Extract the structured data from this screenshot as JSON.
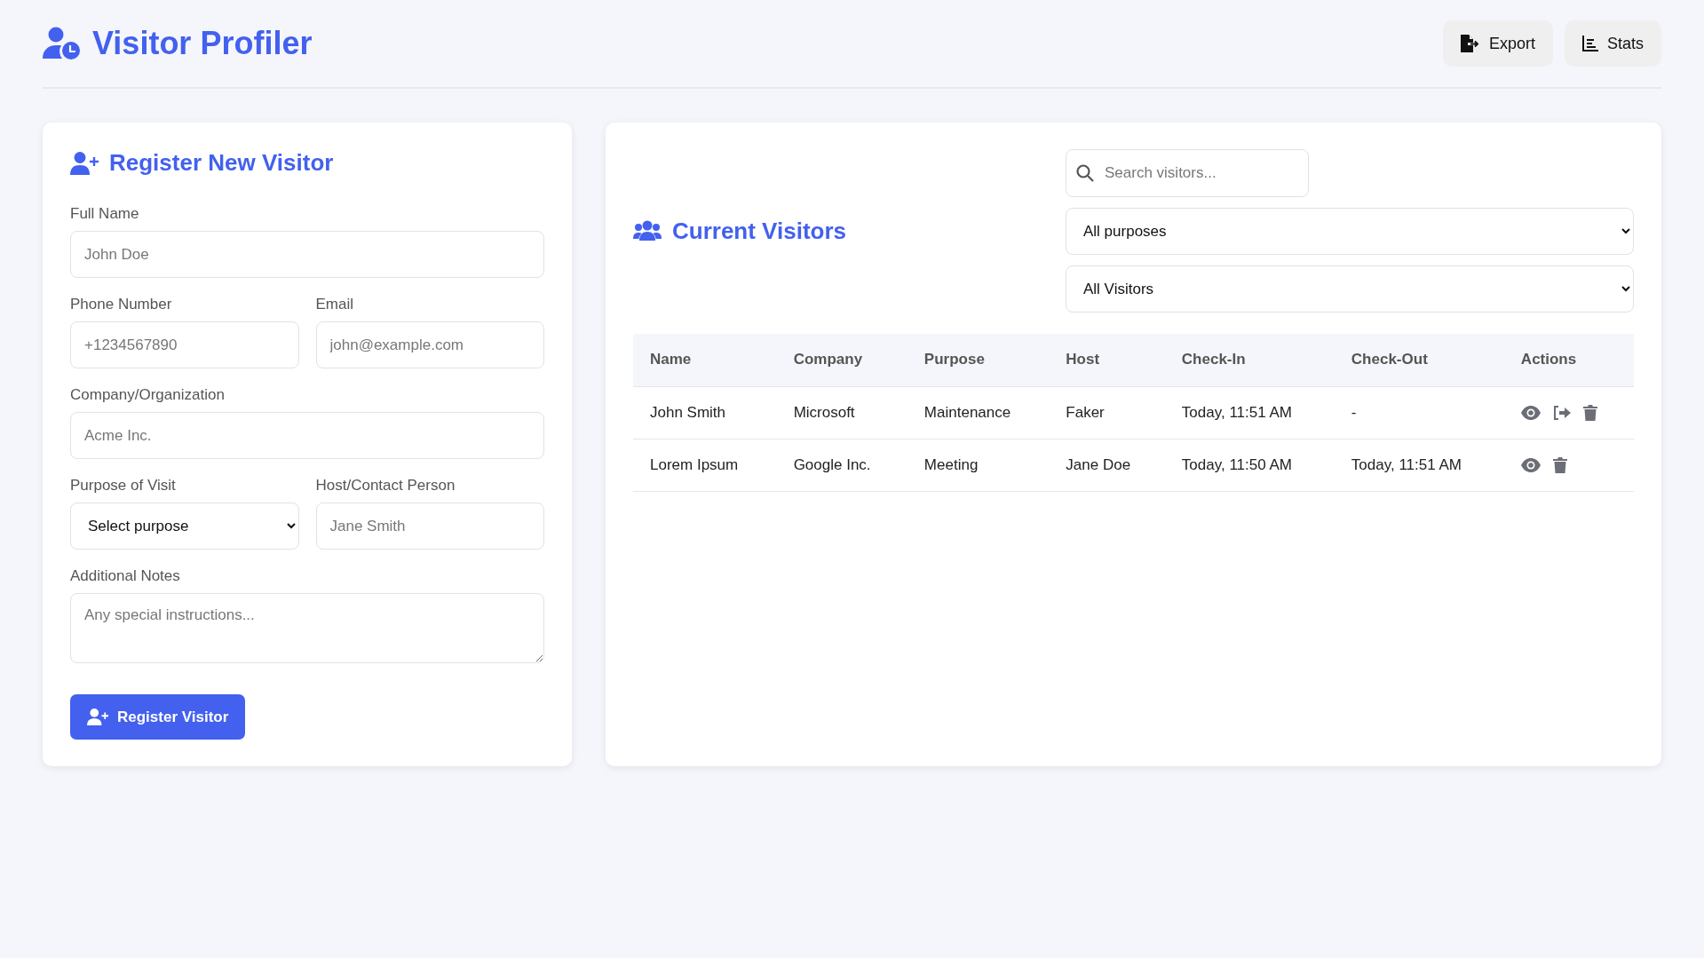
{
  "header": {
    "title": "Visitor Profiler",
    "buttons": [
      {
        "kind": "export",
        "label": "Export"
      },
      {
        "kind": "stats",
        "label": "Stats"
      }
    ]
  },
  "register": {
    "title": "Register New Visitor",
    "rows": [
      [
        {
          "kind": "text",
          "label": "Full Name",
          "placeholder": "John Doe"
        }
      ],
      [
        {
          "kind": "text",
          "label": "Phone Number",
          "placeholder": "+1234567890"
        },
        {
          "kind": "text",
          "label": "Email",
          "placeholder": "john@example.com"
        }
      ],
      [
        {
          "kind": "text",
          "label": "Company/Organization",
          "placeholder": "Acme Inc."
        }
      ],
      [
        {
          "kind": "select",
          "label": "Purpose of Visit",
          "value": "Select purpose"
        },
        {
          "kind": "text",
          "label": "Host/Contact Person",
          "placeholder": "Jane Smith"
        }
      ],
      [
        {
          "kind": "textarea",
          "label": "Additional Notes",
          "placeholder": "Any special instructions..."
        }
      ]
    ],
    "submit": "Register Visitor"
  },
  "visitors": {
    "title": "Current Visitors",
    "search": {
      "placeholder": "Search visitors..."
    },
    "filters": [
      "All purposes",
      "All Visitors"
    ],
    "columns": [
      "Name",
      "Company",
      "Purpose",
      "Host",
      "Check-In",
      "Check-Out",
      "Actions"
    ],
    "rows": [
      {
        "cells": [
          "John Smith",
          "Microsoft",
          "Maintenance",
          "Faker",
          "Today, 11:51 AM",
          "-"
        ],
        "actions": [
          {
            "kind": "view"
          },
          {
            "kind": "checkout"
          },
          {
            "kind": "delete"
          }
        ]
      },
      {
        "cells": [
          "Lorem Ipsum",
          "Google Inc.",
          "Meeting",
          "Jane Doe",
          "Today, 11:50 AM",
          "Today, 11:51 AM"
        ],
        "actions": [
          {
            "kind": "view"
          },
          {
            "kind": "delete"
          }
        ]
      }
    ]
  }
}
